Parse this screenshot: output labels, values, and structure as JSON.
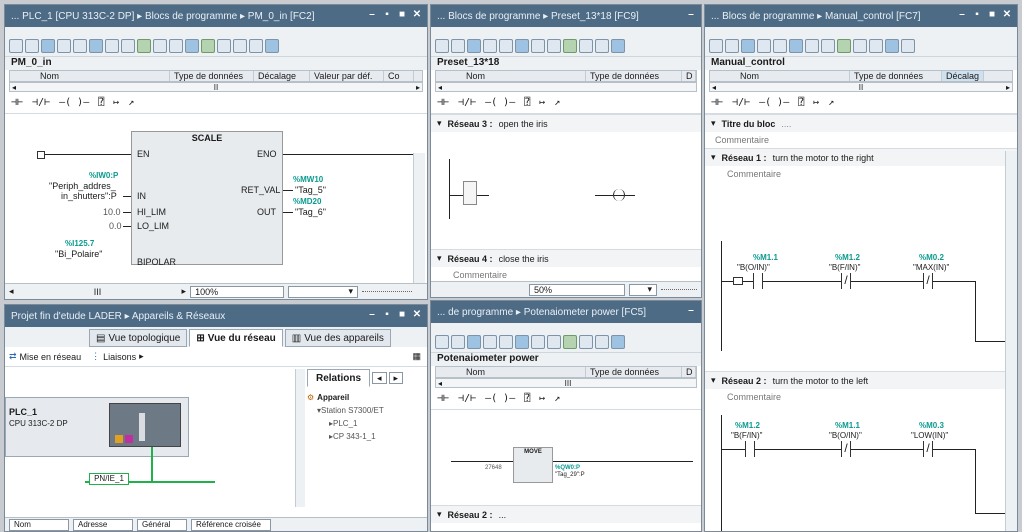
{
  "win1": {
    "title": "... PLC_1 [CPU 313C-2 DP] ▸ Blocs de programme ▸ PM_0_in [FC2]",
    "block": "PM_0_in",
    "iface_headers": [
      "Nom",
      "Type de données",
      "Décalage",
      "Valeur par déf.",
      "Co"
    ],
    "scale": {
      "name": "SCALE",
      "en": "EN",
      "eno": "ENO",
      "in": "IN",
      "hi": "HI_LIM",
      "lo": "LO_LIM",
      "ret": "RET_VAL",
      "out": "OUT",
      "bipolar": "BIPOLAR",
      "in_addr": "%IW0:P",
      "in_tag": "\"Periph_addres_",
      "in_tag2": "in_shutters\":P",
      "hi_val": "10.0",
      "lo_val": "0.0",
      "bi_addr": "%I125.7",
      "bi_tag": "\"Bi_Polaire\"",
      "ret_addr": "%MW10",
      "ret_tag": "\"Tag_5\"",
      "out_addr": "%MD20",
      "out_tag": "\"Tag_6\""
    },
    "zoom": "100%",
    "scroll_mark": "III"
  },
  "win2": {
    "title": "... Blocs de programme ▸ Preset_13*18 [FC9]",
    "block": "Preset_13*18",
    "iface_headers": [
      "Nom",
      "Type de données",
      "D"
    ],
    "net3_label": "Réseau 3 :",
    "net3_title": "open the iris",
    "comment": "Commentaire",
    "net4_label": "Réseau 4 :",
    "net4_title": "close the iris",
    "zoom": "50%"
  },
  "win3": {
    "title": "... de programme ▸ Potenaiometer power [FC5]",
    "block": "Potenaiometer power",
    "iface_headers": [
      "Nom",
      "Type de données",
      "D"
    ],
    "move_name": "MOVE",
    "move_in_val": "27648",
    "move_out": "%QW0:P",
    "move_out_tag": "\"Tag_29\":P",
    "net2_label": "Réseau 2 :",
    "net2_title": "..."
  },
  "win4": {
    "title": "... Blocs de programme ▸ Manual_control [FC7]",
    "block": "Manual_control",
    "iface_headers": [
      "Nom",
      "Type de données",
      "Décalag"
    ],
    "bloc_title": "Titre du bloc",
    "bloc_title_suffix": "....",
    "comment": "Commentaire",
    "net1_label": "Réseau 1 :",
    "net1_title": "turn the motor to the right",
    "net1_contacts": [
      {
        "addr": "%M1.1",
        "tag": "\"B(O/IN)\""
      },
      {
        "addr": "%M1.2",
        "tag": "\"B(F/IN)\""
      },
      {
        "addr": "%M0.2",
        "tag": "\"MAX(IN)\""
      }
    ],
    "net2_label": "Réseau 2 :",
    "net2_title": "turn the motor to the left",
    "net2_contacts": [
      {
        "addr": "%M1.2",
        "tag": "\"B(F/IN)\""
      },
      {
        "addr": "%M1.1",
        "tag": "\"B(O/IN)\""
      },
      {
        "addr": "%M0.3",
        "tag": "\"LOW(IN)\""
      }
    ]
  },
  "win5": {
    "title": "Projet fin d'etude LADER ▸ Appareils & Réseaux",
    "tabs": [
      "Vue topologique",
      "Vue du réseau",
      "Vue des appareils"
    ],
    "mise_en_reseau": "Mise en réseau",
    "liaisons": "Liaisons",
    "plc_name": "PLC_1",
    "plc_cpu": "CPU 313C-2 DP",
    "subnet": "PN/IE_1",
    "relations_tab": "Relations",
    "tree": {
      "root": "Appareil",
      "station": "Station S7300/ET",
      "plc": "PLC_1",
      "cp": "CP 343-1_1"
    },
    "footer_cols": [
      "Nom",
      "Adresse"
    ],
    "footer_extra": [
      "Général",
      "Référence croisée"
    ]
  },
  "colors": {
    "titlebar": "#4d6b85",
    "tag_teal": "#0a9a90",
    "accent_green": "#22b04a"
  }
}
